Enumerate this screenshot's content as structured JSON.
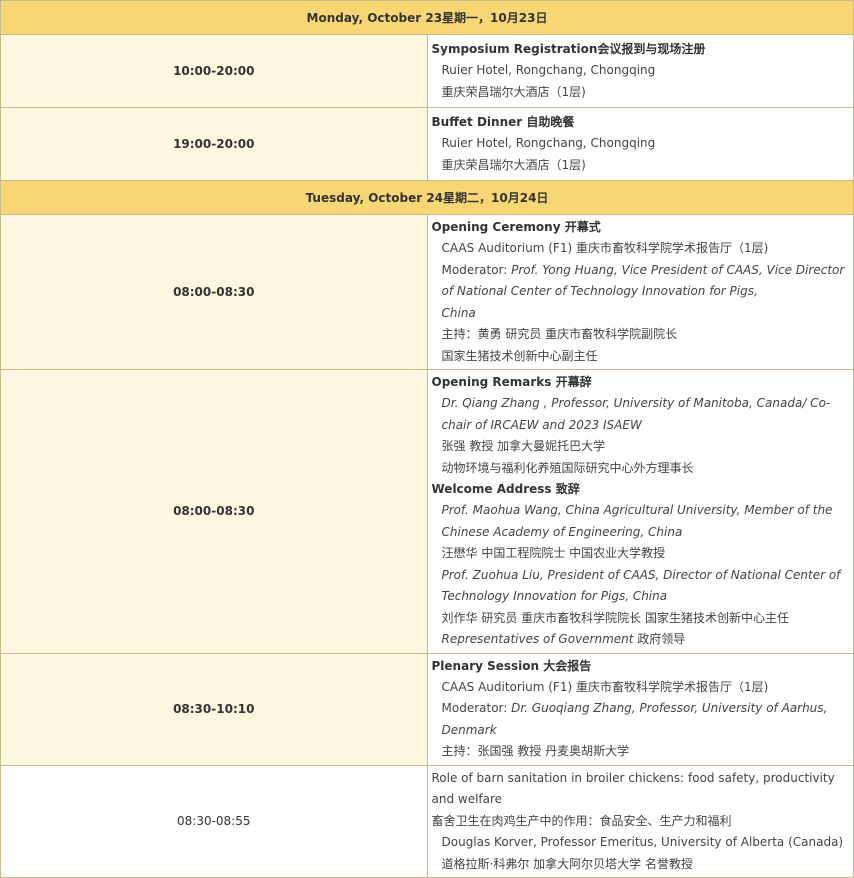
{
  "day1": {
    "header": "Monday, October 23星期一，10月23日"
  },
  "reg": {
    "time": "10:00-20:00",
    "title": "Symposium Registration会议报到与现场注册",
    "venue_en": "Ruier Hotel, Rongchang, Chongqing",
    "venue_cn": "重庆荣昌瑞尔大酒店（1层)"
  },
  "dinner": {
    "time": "19:00-20:00",
    "title": "Buffet Dinner 自助晚餐",
    "venue_en": "Ruier Hotel, Rongchang, Chongqing",
    "venue_cn": "重庆荣昌瑞尔大酒店（1层)"
  },
  "day2": {
    "header": "Tuesday, October 24星期二，10月24日"
  },
  "opening": {
    "time": "08:00-08:30",
    "title": "Opening Ceremony 开幕式",
    "venue": "CAAS Auditorium (F1) 重庆市畜牧科学院学术报告厅（1层)",
    "moderator_label": "Moderator: ",
    "moderator_name": "Prof. Yong Huang, Vice President of CAAS, Vice Director of National Center of Technology Innovation for Pigs,",
    "moderator_cont": "China",
    "host_cn": "主持：黄勇 研究员 重庆市畜牧科学院副院长",
    "host_cn2": "国家生猪技术创新中心副主任"
  },
  "remarks": {
    "time": "08:00-08:30",
    "title": "Opening Remarks 开幕辞",
    "speaker_en": "Dr. Qiang Zhang , Professor, University of Manitoba, Canada/ Co-chair of IRCAEW and 2023 ISAEW",
    "speaker_cn": "张强 教授 加拿大曼妮托巴大学",
    "speaker_cn2": "动物环境与福利化养殖国际研究中心外方理事长",
    "welcome_title": "Welcome Address 致辞",
    "welcome1_en": "Prof. Maohua Wang, China Agricultural University, Member of the Chinese Academy of Engineering, China",
    "welcome1_cn": "汪懋华 中国工程院院士 中国农业大学教授",
    "welcome2_en": "Prof. Zuohua Liu, President of CAAS, Director of National Center of Technology Innovation for Pigs, China",
    "welcome2_cn": "刘作华 研究员 重庆市畜牧科学院院长 国家生猪技术创新中心主任",
    "gov_en": "Representatives of Government",
    "gov_cn": " 政府领导"
  },
  "plenary": {
    "time": "08:30-10:10",
    "title": "Plenary Session 大会报告",
    "venue": "CAAS Auditorium (F1) 重庆市畜牧科学院学术报告厅（1层)",
    "moderator_label": "Moderator: ",
    "moderator_name": "Dr. Guoqiang Zhang, Professor, University of Aarhus, Denmark",
    "host_cn": "主持：张国强 教授 丹麦奥胡斯大学"
  },
  "talk1": {
    "time": "08:30-08:55",
    "title_en": "Role of barn sanitation in broiler chickens: food safety, productivity and welfare",
    "title_cn": "畜舍卫生在肉鸡生产中的作用：食品安全、生产力和福利",
    "speaker_en": "Douglas Korver, Professor Emeritus, University of Alberta (Canada)",
    "speaker_cn": "道格拉斯·科弗尔 加拿大阿尔贝塔大学 名誉教授"
  }
}
